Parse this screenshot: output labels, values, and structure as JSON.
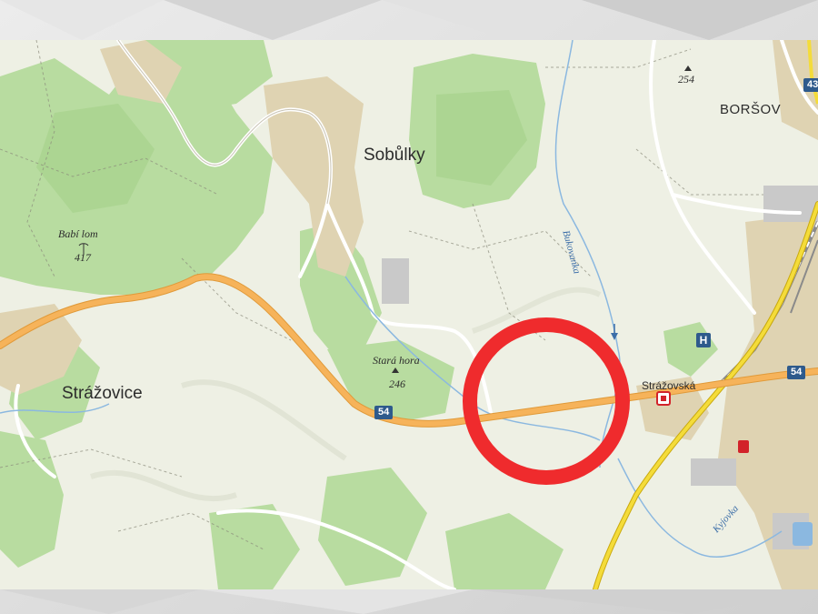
{
  "map": {
    "places": {
      "sobulky": "Sobůlky",
      "strazovice": "Strážovice",
      "borsov": "BORŠOV"
    },
    "peaks": {
      "babi_lom": {
        "name": "Babí lom",
        "elevation": "417"
      },
      "stara_hora": {
        "name": "Stará hora",
        "elevation": "246"
      },
      "unnamed_elevation": "254"
    },
    "rivers": {
      "bukovanka": "Bukovanka",
      "kyjovka": "Kyjovka"
    },
    "streets": {
      "strazovska": "Strážovská"
    },
    "road_numbers": {
      "route_54_west": "54",
      "route_54_east": "54",
      "route_43_edge": "43"
    },
    "pois": {
      "hospital": "H"
    },
    "highlight": {
      "shape": "circle",
      "color": "#ef2b2d"
    },
    "colors": {
      "forest": "#b8dca0",
      "land": "#eef0e4",
      "town": "#dfd3b2",
      "main_road": "#f6b35a",
      "yellow_road": "#f4dc3a",
      "water": "#8bb8e0"
    }
  }
}
